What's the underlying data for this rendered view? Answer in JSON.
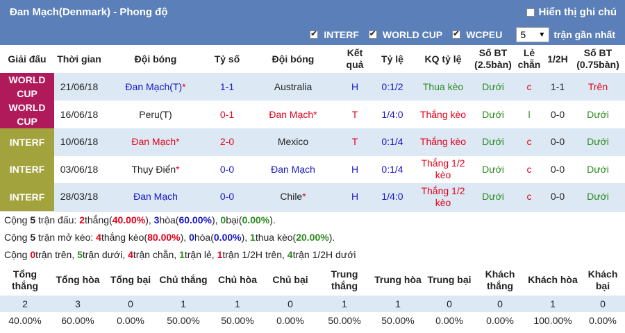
{
  "header": {
    "title": "Đan Mạch(Denmark) - Phong độ",
    "show_notes_label": "Hiển thị ghi chú"
  },
  "filters": {
    "items": [
      {
        "label": "INTERF",
        "checked": true
      },
      {
        "label": "WORLD CUP",
        "checked": true
      },
      {
        "label": "WCPEU",
        "checked": true
      }
    ],
    "count_value": "5",
    "count_suffix": "trận gần nhất"
  },
  "table": {
    "headers": [
      "Giải đấu",
      "Thời gian",
      "Đội bóng",
      "Tỷ số",
      "Đội bóng",
      "Kết quả",
      "Tỷ lệ",
      "KQ tỷ lệ",
      "Số BT (2.5bàn)",
      "Lẻ chẵn",
      "1/2H",
      "Số BT (0.75bàn)"
    ],
    "rows": [
      {
        "comp": "WORLD CUP",
        "comp_type": "wc",
        "date": "21/06/18",
        "home": "Đan Mạch(T)",
        "home_star": "*",
        "home_color": "blue",
        "score": "1-1",
        "score_color": "blue",
        "away": "Australia",
        "away_star": "",
        "away_color": "dark",
        "result": "H",
        "result_color": "blue",
        "odds": "0:1/2",
        "odds_color": "blue",
        "odds_result": "Thua kèo",
        "odds_result_color": "green",
        "bt25": "Dưới",
        "bt25_color": "green",
        "oddeven": "c",
        "oddeven_color": "red",
        "half": "1-1",
        "bt075": "Trên",
        "bt075_color": "red"
      },
      {
        "comp": "WORLD CUP",
        "comp_type": "wc",
        "date": "16/06/18",
        "home": "Peru(T)",
        "home_star": "",
        "home_color": "dark",
        "score": "0-1",
        "score_color": "red",
        "away": "Đan Mạch",
        "away_star": "*",
        "away_color": "red",
        "result": "T",
        "result_color": "red",
        "odds": "1/4:0",
        "odds_color": "blue",
        "odds_result": "Thắng kèo",
        "odds_result_color": "red",
        "bt25": "Dưới",
        "bt25_color": "green",
        "oddeven": "l",
        "oddeven_color": "green",
        "half": "0-0",
        "bt075": "Dưới",
        "bt075_color": "green"
      },
      {
        "comp": "INTERF",
        "comp_type": "intf",
        "date": "10/06/18",
        "home": "Đan Mạch",
        "home_star": "*",
        "home_color": "red",
        "score": "2-0",
        "score_color": "red",
        "away": "Mexico",
        "away_star": "",
        "away_color": "dark",
        "result": "T",
        "result_color": "red",
        "odds": "0:1/4",
        "odds_color": "blue",
        "odds_result": "Thắng kèo",
        "odds_result_color": "red",
        "bt25": "Dưới",
        "bt25_color": "green",
        "oddeven": "c",
        "oddeven_color": "red",
        "half": "0-0",
        "bt075": "Dưới",
        "bt075_color": "green"
      },
      {
        "comp": "INTERF",
        "comp_type": "intf",
        "date": "03/06/18",
        "home": "Thụy Điển",
        "home_star": "*",
        "home_color": "dark",
        "score": "0-0",
        "score_color": "blue",
        "away": "Đan Mạch",
        "away_star": "",
        "away_color": "blue",
        "result": "H",
        "result_color": "blue",
        "odds": "0:1/4",
        "odds_color": "blue",
        "odds_result": "Thắng 1/2 kèo",
        "odds_result_color": "red",
        "bt25": "Dưới",
        "bt25_color": "green",
        "oddeven": "c",
        "oddeven_color": "red",
        "half": "0-0",
        "bt075": "Dưới",
        "bt075_color": "green"
      },
      {
        "comp": "INTERF",
        "comp_type": "intf",
        "date": "28/03/18",
        "home": "Đan Mạch",
        "home_star": "",
        "home_color": "blue",
        "score": "0-0",
        "score_color": "blue",
        "away": "Chile",
        "away_star": "*",
        "away_color": "dark",
        "result": "H",
        "result_color": "blue",
        "odds": "1/4:0",
        "odds_color": "blue",
        "odds_result": "Thắng 1/2 kèo",
        "odds_result_color": "red",
        "bt25": "Dưới",
        "bt25_color": "green",
        "oddeven": "c",
        "oddeven_color": "red",
        "half": "0-0",
        "bt075": "Dưới",
        "bt075_color": "green"
      }
    ]
  },
  "summary": {
    "line1": [
      {
        "t": "Cộng ",
        "c": ""
      },
      {
        "t": "5",
        "c": "b"
      },
      {
        "t": " trận đấu: ",
        "c": ""
      },
      {
        "t": "2",
        "c": "red"
      },
      {
        "t": "thắng(",
        "c": ""
      },
      {
        "t": "40.00%",
        "c": "red"
      },
      {
        "t": "), ",
        "c": ""
      },
      {
        "t": "3",
        "c": "blue"
      },
      {
        "t": "hòa(",
        "c": ""
      },
      {
        "t": "60.00%",
        "c": "blue"
      },
      {
        "t": "), ",
        "c": ""
      },
      {
        "t": "0",
        "c": "green"
      },
      {
        "t": "bại(",
        "c": ""
      },
      {
        "t": "0.00%",
        "c": "green"
      },
      {
        "t": ").",
        "c": ""
      }
    ],
    "line2": [
      {
        "t": "Cộng ",
        "c": ""
      },
      {
        "t": "5",
        "c": "b"
      },
      {
        "t": " trận mở kèo: ",
        "c": ""
      },
      {
        "t": "4",
        "c": "red"
      },
      {
        "t": "thắng kèo(",
        "c": ""
      },
      {
        "t": "80.00%",
        "c": "red"
      },
      {
        "t": "), ",
        "c": ""
      },
      {
        "t": "0",
        "c": "blue"
      },
      {
        "t": "hòa(",
        "c": ""
      },
      {
        "t": "0.00%",
        "c": "blue"
      },
      {
        "t": "), ",
        "c": ""
      },
      {
        "t": "1",
        "c": "green"
      },
      {
        "t": "thua kèo(",
        "c": ""
      },
      {
        "t": "20.00%",
        "c": "green"
      },
      {
        "t": ").",
        "c": ""
      }
    ],
    "line3": [
      {
        "t": "Cộng ",
        "c": ""
      },
      {
        "t": "0",
        "c": "red"
      },
      {
        "t": "trận trên, ",
        "c": ""
      },
      {
        "t": "5",
        "c": "green"
      },
      {
        "t": "trận dưới, ",
        "c": ""
      },
      {
        "t": "4",
        "c": "red"
      },
      {
        "t": "trận chẵn, ",
        "c": ""
      },
      {
        "t": "1",
        "c": "green"
      },
      {
        "t": "trận lẻ, ",
        "c": ""
      },
      {
        "t": "1",
        "c": "red"
      },
      {
        "t": "trận 1/2H trên, ",
        "c": ""
      },
      {
        "t": "4",
        "c": "green"
      },
      {
        "t": "trận 1/2H dưới",
        "c": ""
      }
    ]
  },
  "stats": {
    "headers": [
      "Tổng thắng",
      "Tổng hòa",
      "Tổng bại",
      "Chủ thắng",
      "Chủ hòa",
      "Chủ bại",
      "Trung thắng",
      "Trung hòa",
      "Trung bại",
      "Khách thắng",
      "Khách hòa",
      "Khách bại"
    ],
    "counts": [
      "2",
      "3",
      "0",
      "1",
      "1",
      "0",
      "1",
      "1",
      "0",
      "0",
      "1",
      "0"
    ],
    "percents": [
      "40.00%",
      "60.00%",
      "0.00%",
      "50.00%",
      "50.00%",
      "0.00%",
      "50.00%",
      "50.00%",
      "0.00%",
      "0.00%",
      "100.00%",
      "0.00%"
    ]
  }
}
